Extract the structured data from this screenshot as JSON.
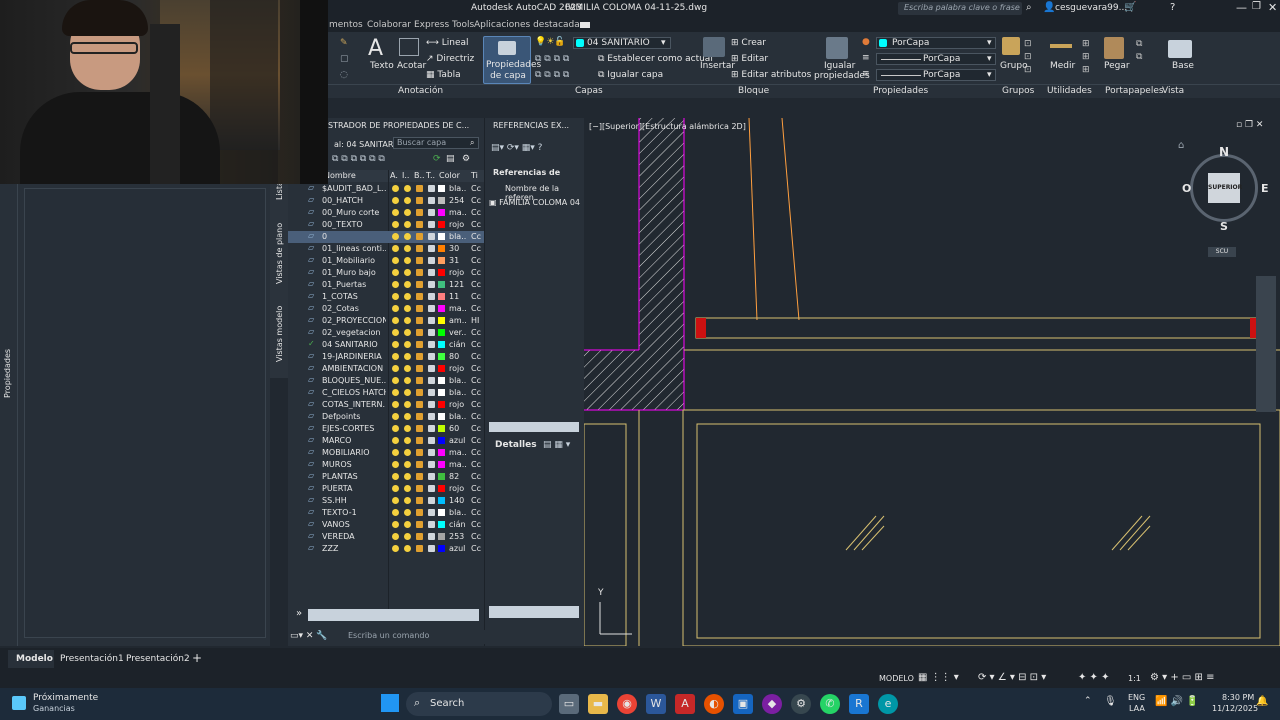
{
  "titlebar": {
    "app_title": "Autodesk AutoCAD 2023",
    "file_name": "FAMILIA COLOMA 04-11-25.dwg",
    "search_placeholder": "Escriba palabra clave o frase",
    "user": "cesguevara99..."
  },
  "tabs": [
    "mentos",
    "Colaborar",
    "Express Tools",
    "Aplicaciones destacadas"
  ],
  "ribbon": {
    "texto": "Texto",
    "acotar": "Acotar",
    "lineal": "Lineal",
    "directriz": "Directriz",
    "tabla": "Tabla",
    "anotacion": "Anotación",
    "propiedades_capa": "Propiedades",
    "de_capa": "de capa",
    "layer_current": "04 SANITARIO",
    "establecer": "Establecer como actual",
    "igualar_capa": "Igualar capa",
    "capas": "Capas",
    "insertar": "Insertar",
    "crear": "Crear",
    "editar": "Editar",
    "editar_atributos": "Editar atributos",
    "bloque": "Bloque",
    "igualar": "Igualar",
    "propiedades_l": "propiedades",
    "porcapa1": "PorCapa",
    "porcapa2": "PorCapa",
    "porcapa3": "PorCapa",
    "propiedades": "Propiedades",
    "grupo": "Grupo",
    "grupos": "Grupos",
    "medir": "Medir",
    "utilidades": "Utilidades",
    "pegar": "Pegar",
    "portapapeles": "Portapapeles",
    "base": "Base",
    "vista": "Vista"
  },
  "side": {
    "propiedades": "Propiedades",
    "lista": "Lista",
    "vistas_plano": "Vistas de plano",
    "vistas_modelo": "Vistas modelo"
  },
  "layer_panel": {
    "title": "STRADOR DE PROPIEDADES DE C...",
    "current": "al: 04 SANITARIO",
    "search_placeholder": "Buscar capa",
    "col_nombre": "Nombre",
    "col_a": "A.",
    "col_i": "I..",
    "col_b": "B..",
    "col_t": "T..",
    "col_color": "Color",
    "col_ti": "Ti"
  },
  "layers": [
    {
      "name": "$AUDIT_BAD_L...",
      "color_name": "bla...",
      "color": "#ffffff",
      "lt": "Cc"
    },
    {
      "name": "00_HATCH",
      "color_name": "254",
      "color": "#bdbdbd",
      "lt": "Cc"
    },
    {
      "name": "00_Muro corte",
      "color_name": "ma...",
      "color": "#ff00ff",
      "lt": "Cc"
    },
    {
      "name": "00_TEXTO",
      "color_name": "rojo",
      "color": "#ff0000",
      "lt": "Cc"
    },
    {
      "name": "0",
      "color_name": "bla...",
      "color": "#ffffff",
      "lt": "Cc"
    },
    {
      "name": "01_lineas conti...",
      "color_name": "30",
      "color": "#ff7f00",
      "lt": "Cc"
    },
    {
      "name": "01_Mobiliario",
      "color_name": "31",
      "color": "#ff9f5f",
      "lt": "Cc"
    },
    {
      "name": "01_Muro bajo",
      "color_name": "rojo",
      "color": "#ff0000",
      "lt": "Cc"
    },
    {
      "name": "01_Puertas",
      "color_name": "121",
      "color": "#3fbf7f",
      "lt": "Cc"
    },
    {
      "name": "1_COTAS",
      "color_name": "11",
      "color": "#ff7f7f",
      "lt": "Cc"
    },
    {
      "name": "02_Cotas",
      "color_name": "ma...",
      "color": "#ff00ff",
      "lt": "Cc"
    },
    {
      "name": "02_PROYECCION",
      "color_name": "am...",
      "color": "#ffff00",
      "lt": "HI"
    },
    {
      "name": "02_vegetacion",
      "color_name": "ver...",
      "color": "#00ff00",
      "lt": "Cc"
    },
    {
      "name": "04 SANITARIO",
      "color_name": "cián",
      "color": "#00ffff",
      "lt": "Cc"
    },
    {
      "name": "19-JARDINERIA",
      "color_name": "80",
      "color": "#3fff3f",
      "lt": "Cc"
    },
    {
      "name": "AMBIENTACION",
      "color_name": "rojo",
      "color": "#ff0000",
      "lt": "Cc"
    },
    {
      "name": "BLOQUES_NUE...",
      "color_name": "bla...",
      "color": "#ffffff",
      "lt": "Cc"
    },
    {
      "name": "C_CIELOS HATCH",
      "color_name": "bla...",
      "color": "#ffffff",
      "lt": "Cc"
    },
    {
      "name": "COTAS_INTERN...",
      "color_name": "rojo",
      "color": "#ff0000",
      "lt": "Cc"
    },
    {
      "name": "Defpoints",
      "color_name": "bla...",
      "color": "#ffffff",
      "lt": "Cc"
    },
    {
      "name": "EJES-CORTES",
      "color_name": "60",
      "color": "#bfff00",
      "lt": "Cc"
    },
    {
      "name": "MARCO",
      "color_name": "azul",
      "color": "#0000ff",
      "lt": "Cc"
    },
    {
      "name": "MOBILIARIO",
      "color_name": "ma...",
      "color": "#ff00ff",
      "lt": "Cc"
    },
    {
      "name": "MUROS",
      "color_name": "ma...",
      "color": "#ff00ff",
      "lt": "Cc"
    },
    {
      "name": "PLANTAS",
      "color_name": "82",
      "color": "#3fbf3f",
      "lt": "Cc"
    },
    {
      "name": "PUERTA",
      "color_name": "rojo",
      "color": "#ff0000",
      "lt": "Cc"
    },
    {
      "name": "SS.HH",
      "color_name": "140",
      "color": "#00bfff",
      "lt": "Cc"
    },
    {
      "name": "TEXTO-1",
      "color_name": "bla...",
      "color": "#ffffff",
      "lt": "Cc"
    },
    {
      "name": "VANOS",
      "color_name": "cián",
      "color": "#00ffff",
      "lt": "Cc"
    },
    {
      "name": "VEREDA",
      "color_name": "253",
      "color": "#a5a5a5",
      "lt": "Cc"
    },
    {
      "name": "ZZZ",
      "color_name": "azul",
      "color": "#0000ff",
      "lt": "Cc"
    }
  ],
  "ref_panel": {
    "title": "REFERENCIAS EX...",
    "sub": "Referencias de",
    "col": "Nombre de la referen",
    "file": "FAMILIA COLOMA 04",
    "detalles": "Detalles"
  },
  "canvas": {
    "view_label": "[−][Superior][Estructura alámbrica 2D]",
    "north": "N",
    "south": "S",
    "east": "E",
    "west": "O",
    "superior": "SUPERIOR",
    "scu": "SCU",
    "y": "Y"
  },
  "command": {
    "placeholder": "Escriba un comando"
  },
  "bottom_tabs": [
    "Modelo",
    "Presentación1",
    "Presentación2"
  ],
  "status": {
    "modelo": "MODELO",
    "scale": "1:1"
  },
  "taskbar": {
    "weather_title": "Próximamente",
    "weather_sub": "Ganancias",
    "search": "Search",
    "lang1": "ENG",
    "lang2": "LAA",
    "time": "8:30 PM",
    "date": "11/12/2025"
  }
}
